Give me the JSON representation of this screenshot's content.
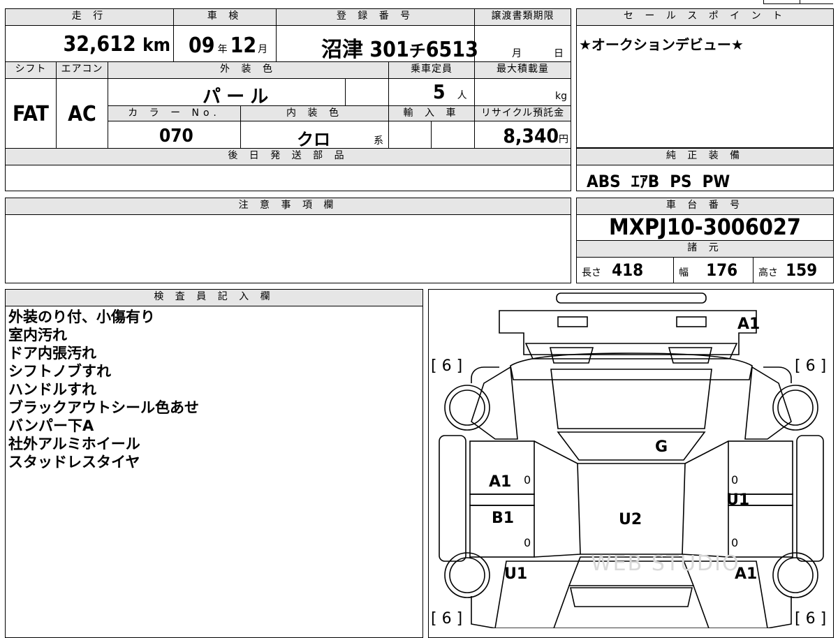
{
  "main": {
    "mileage_label": "走 行",
    "mileage": "32,612",
    "mileage_unit": "km",
    "shaken_label": "車 検",
    "shaken_year": "09",
    "shaken_year_unit": "年",
    "shaken_month": "12",
    "shaken_month_unit": "月",
    "plate_label": "登 録 番 号",
    "plate_city": "沼津",
    "plate_number": "301",
    "plate_kana": "チ",
    "plate_serial": "6513",
    "deadline_label": "譲渡書類期限",
    "deadline_month_unit": "月",
    "deadline_day_unit": "日",
    "shift_label": "シフト",
    "shift": "FAT",
    "ac_label": "エアコン",
    "ac": "AC",
    "exterior_label": "外 装 色",
    "exterior": "パ ー ル",
    "capacity_label": "乗車定員",
    "capacity": "5",
    "capacity_unit": "人",
    "load_label": "最大積載量",
    "load_unit": "kg",
    "color_no_label": "カ ラ ー No.",
    "color_no": "070",
    "interior_label": "内 装 色",
    "interior": "クロ",
    "interior_unit": "系",
    "import_label": "輸 入 車",
    "recycle_label": "リサイクル預託金",
    "recycle": "8,340",
    "recycle_unit": "円"
  },
  "later_parts_label": "後 日 発 送 部 品",
  "caution_label": "注 意 事 項 欄",
  "sales": {
    "label": "セ ー ル ス ポ イ ン ト",
    "text": "★オークションデビュー★"
  },
  "equipment": {
    "label": "純 正 装 備",
    "text": "ABS  ｴｱB  PS  PW"
  },
  "chassis": {
    "label": "車 台 番 号",
    "number": "MXPJ10-3006027",
    "specs_label": "諸 元",
    "length_label": "長さ",
    "length": "418",
    "width_label": "幅",
    "width": "176",
    "height_label": "高さ",
    "height": "159"
  },
  "inspector": {
    "label": "検 査 員 記 入 欄",
    "notes": [
      "外装のり付、小傷有り",
      "室内汚れ",
      "ドア内張汚れ",
      "シフトノブすれ",
      "ハンドルすれ",
      "ブラックアウトシール色あせ",
      "バンパー下A",
      "社外アルミホイール",
      "スタッドレスタイヤ"
    ]
  },
  "diagram": {
    "tl": "[ 6 ]",
    "tr": "[ 6 ]",
    "bl": "[ 6 ]",
    "br": "[ 6 ]",
    "a1_top": "A1",
    "g": "G",
    "a1_left": "A1",
    "b1": "B1",
    "u2": "U2",
    "u1_right": "U1",
    "u1_left": "U1",
    "a1_right": "A1",
    "zero": "0",
    "watermark": "WEB STUDIO"
  }
}
